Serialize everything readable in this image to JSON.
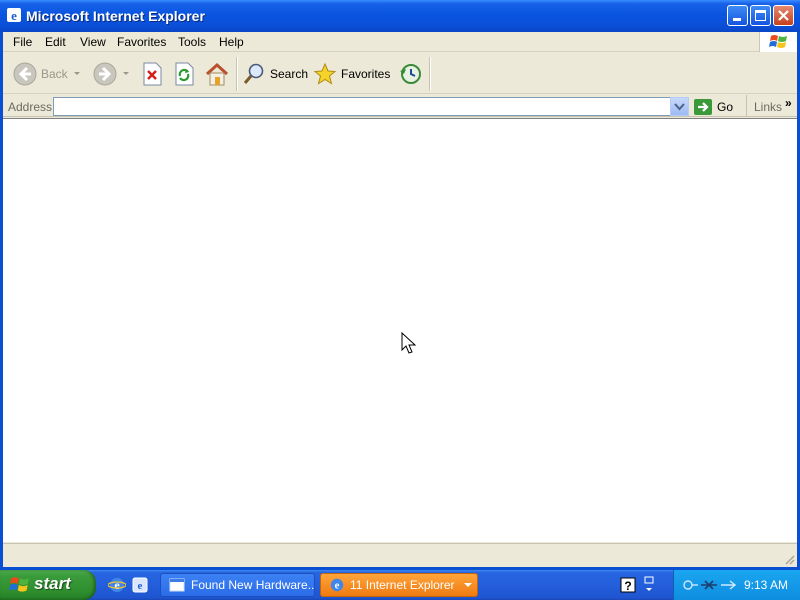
{
  "window": {
    "title": "Microsoft Internet Explorer"
  },
  "menu": {
    "items": [
      "File",
      "Edit",
      "View",
      "Favorites",
      "Tools",
      "Help"
    ]
  },
  "toolbar": {
    "back_label": "Back",
    "search_label": "Search",
    "favorites_label": "Favorites"
  },
  "address": {
    "label": "Address",
    "value": "",
    "go_label": "Go",
    "links_label": "Links",
    "links_chevron": "»"
  },
  "taskbar": {
    "start_label": "start",
    "tasks": [
      {
        "label": "Found New Hardware..."
      },
      {
        "label": "11 Internet Explorer"
      }
    ],
    "clock": "9:13 AM"
  },
  "colors": {
    "titlebar": "#0a55e0",
    "taskbar": "#245edb",
    "start_green": "#3a9b3a",
    "active_task": "#f58a1f",
    "tray": "#1aa6f0"
  }
}
